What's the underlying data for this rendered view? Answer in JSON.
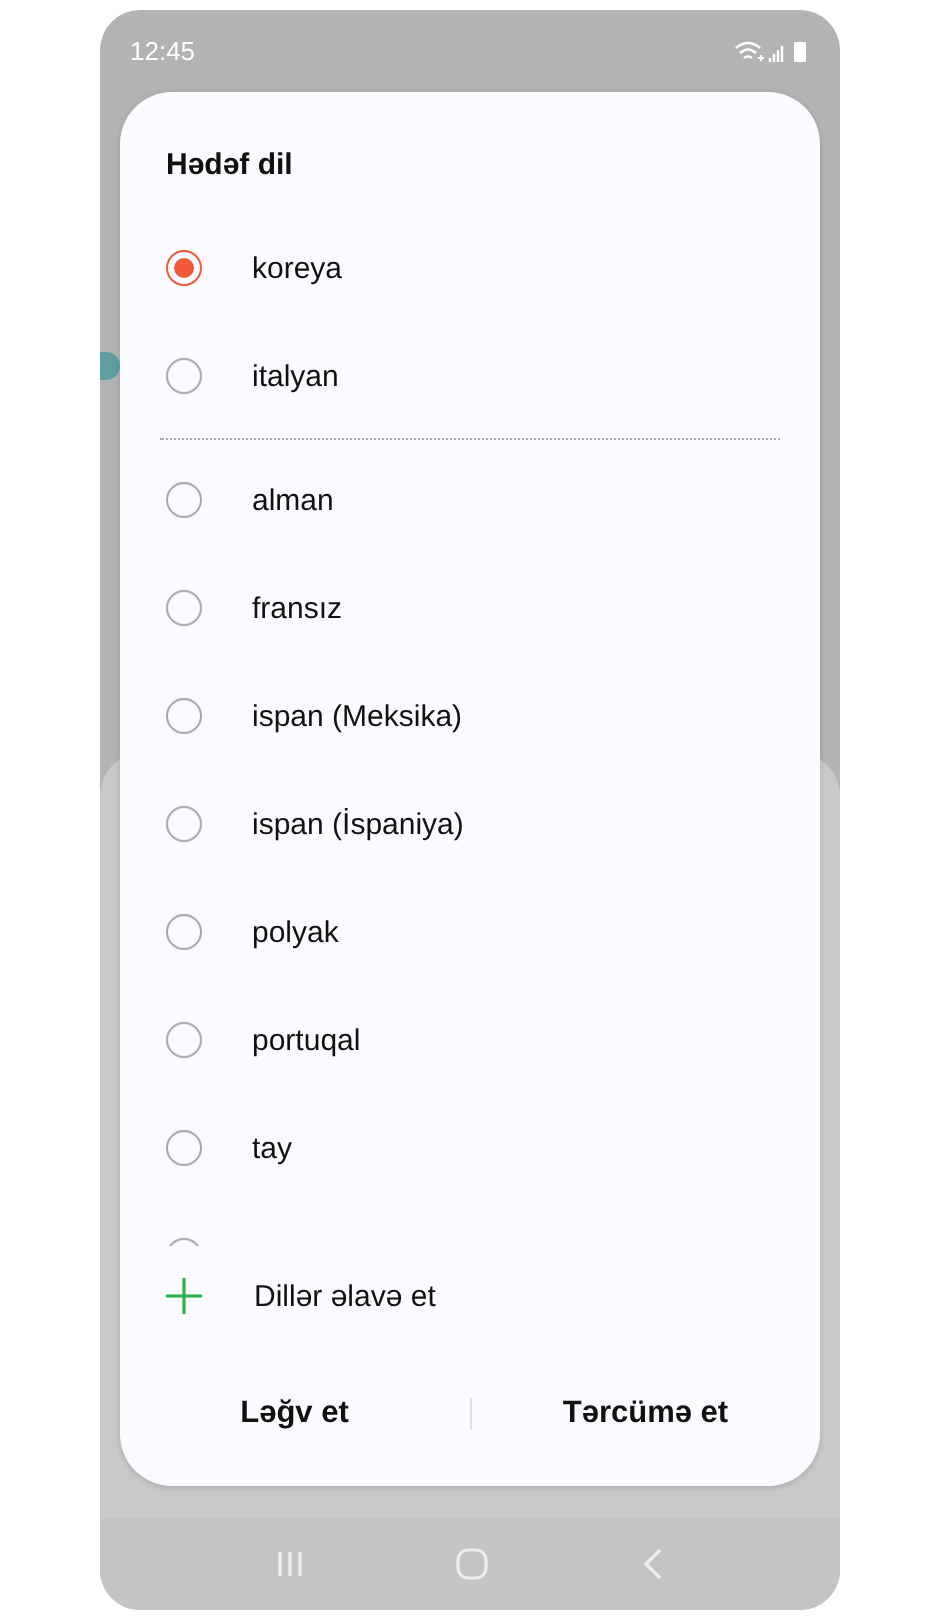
{
  "status_bar": {
    "time": "12:45"
  },
  "dialog": {
    "title": "Hədəf dil",
    "recent_languages": [
      {
        "label": "koreya",
        "selected": true
      },
      {
        "label": "italyan",
        "selected": false
      }
    ],
    "languages": [
      {
        "label": "alman",
        "selected": false
      },
      {
        "label": "fransız",
        "selected": false
      },
      {
        "label": "ispan (Meksika)",
        "selected": false
      },
      {
        "label": "ispan (İspaniya)",
        "selected": false
      },
      {
        "label": "polyak",
        "selected": false
      },
      {
        "label": "portuqal",
        "selected": false
      },
      {
        "label": "tay",
        "selected": false
      },
      {
        "selected": false
      }
    ],
    "add_languages": "Dillər əlavə et",
    "buttons": [
      "Ləğv et",
      "Tərcümə et"
    ]
  }
}
